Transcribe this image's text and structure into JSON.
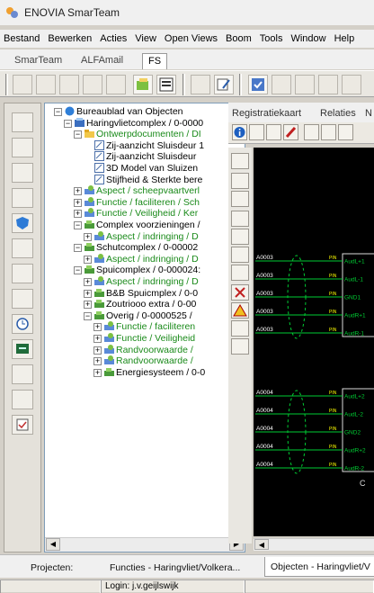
{
  "window": {
    "title": "ENOVIA SmarTeam"
  },
  "menu": [
    "Bestand",
    "Bewerken",
    "Acties",
    "View",
    "Open Views",
    "Boom",
    "Tools",
    "Window",
    "Help"
  ],
  "top_tabs": [
    {
      "label": "SmarTeam",
      "active": false
    },
    {
      "label": "ALFAmail",
      "active": false
    },
    {
      "label": "FS",
      "active": true
    }
  ],
  "tree": [
    {
      "text": "Bureaublad van Objecten",
      "depth": 0,
      "expander": "−",
      "icon": "globe-icon",
      "green": false
    },
    {
      "text": "Haringvlietcomplex / 0-0000",
      "depth": 1,
      "expander": "−",
      "icon": "project-icon",
      "green": false
    },
    {
      "text": "Ontwerpdocumenten / DI",
      "depth": 2,
      "expander": "−",
      "icon": "folder-icon",
      "green": true
    },
    {
      "text": "Zij-aanzicht Sluisdeur 1",
      "depth": 3,
      "expander": "",
      "icon": "drawing-icon",
      "green": false
    },
    {
      "text": "Zij-aanzicht Sluisdeur",
      "depth": 3,
      "expander": "",
      "icon": "drawing-icon",
      "green": false
    },
    {
      "text": "3D Model van Sluizen",
      "depth": 3,
      "expander": "",
      "icon": "drawing-icon",
      "green": false
    },
    {
      "text": "Stijfheid & Sterkte bere",
      "depth": 3,
      "expander": "",
      "icon": "drawing-icon",
      "green": false
    },
    {
      "text": "Aspect / scheepvaartverl",
      "depth": 2,
      "expander": "+",
      "icon": "aspect-icon",
      "green": true
    },
    {
      "text": "Functie / faciliteren / Sch",
      "depth": 2,
      "expander": "+",
      "icon": "aspect-icon",
      "green": true
    },
    {
      "text": "Functie / Veiligheid / Ker",
      "depth": 2,
      "expander": "+",
      "icon": "aspect-icon",
      "green": true
    },
    {
      "text": "Complex voorzieningen /",
      "depth": 2,
      "expander": "−",
      "icon": "component-icon",
      "green": false
    },
    {
      "text": "Aspect / indringing / D",
      "depth": 3,
      "expander": "+",
      "icon": "aspect-icon",
      "green": true
    },
    {
      "text": "Schutcomplex / 0-00002",
      "depth": 2,
      "expander": "−",
      "icon": "component-icon",
      "green": false
    },
    {
      "text": "Aspect / indringing / D",
      "depth": 3,
      "expander": "+",
      "icon": "aspect-icon",
      "green": true
    },
    {
      "text": "Spuicomplex / 0-000024:",
      "depth": 2,
      "expander": "−",
      "icon": "component-icon",
      "green": false
    },
    {
      "text": "Aspect / indringing / D",
      "depth": 3,
      "expander": "+",
      "icon": "aspect-icon",
      "green": true
    },
    {
      "text": "B&B Spuicmplex / 0-0",
      "depth": 3,
      "expander": "+",
      "icon": "component-icon",
      "green": false
    },
    {
      "text": "Zoutriooo extra / 0-00",
      "depth": 3,
      "expander": "+",
      "icon": "component-icon",
      "green": false
    },
    {
      "text": "Overig / 0-0000525 /",
      "depth": 3,
      "expander": "−",
      "icon": "component-icon",
      "green": false
    },
    {
      "text": "Functie / faciliteren",
      "depth": 4,
      "expander": "+",
      "icon": "aspect-icon",
      "green": true
    },
    {
      "text": "Functie / Veiligheid",
      "depth": 4,
      "expander": "+",
      "icon": "aspect-icon",
      "green": true
    },
    {
      "text": "Randvoorwaarde /",
      "depth": 4,
      "expander": "+",
      "icon": "aspect-icon",
      "green": true
    },
    {
      "text": "Randvoorwaarde /",
      "depth": 4,
      "expander": "+",
      "icon": "aspect-icon",
      "green": true
    },
    {
      "text": "Energiesysteem / 0-0",
      "depth": 4,
      "expander": "+",
      "icon": "component-icon",
      "green": false
    }
  ],
  "right_tabs": [
    "Registratiekaart",
    "Relaties",
    "N"
  ],
  "canvas": {
    "left_labels": [
      "A0003",
      "A0003",
      "A0003",
      "A0003",
      "A0003",
      "A0004",
      "A0004",
      "A0004",
      "A0004",
      "A0004"
    ],
    "pin_labels": [
      "PIN",
      "PIN",
      "PIN",
      "PIN",
      "PIN",
      "PIN",
      "PIN",
      "PIN",
      "PIN",
      "PIN"
    ],
    "port_labels": [
      "AudL+1",
      "AudL-1",
      "GND1",
      "AudR+1",
      "AudR-1",
      "AudL+2",
      "AudL-2",
      "GND2",
      "AudR+2",
      "AudR-2"
    ],
    "box_label": "C"
  },
  "bottom_tabs": [
    {
      "label": "Projecten:",
      "active": false
    },
    {
      "label": "Functies - Haringvliet/Volkera...",
      "active": false
    },
    {
      "label": "Objecten - Haringvliet/V",
      "active": true
    }
  ],
  "status": {
    "login": "Login: j.v.geijlswijk"
  },
  "colors": {
    "green_text": "#1a8a1a",
    "canvas_bg": "#000000",
    "canvas_line": "#00cc33",
    "canvas_text": "#ffffff",
    "pin_text": "#ffff00"
  }
}
